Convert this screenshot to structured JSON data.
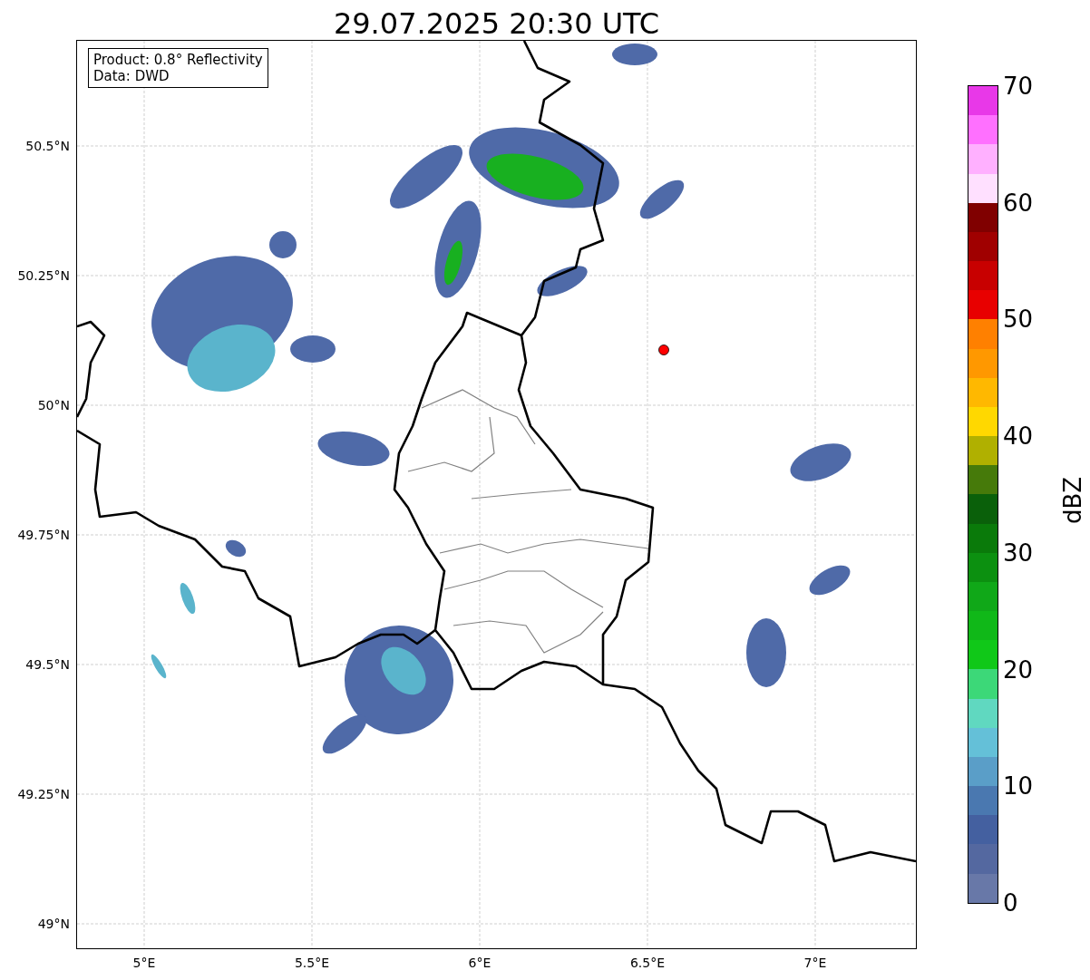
{
  "title": "29.07.2025 20:30 UTC",
  "legend": [
    "Product: 0.8° Reflectivity",
    "Data: DWD"
  ],
  "map": {
    "lon_labels": [
      "5°E",
      "5.5°E",
      "6°E",
      "6.5°E",
      "7°E"
    ],
    "lat_labels": [
      "50.5°N",
      "50.25°N",
      "50°N",
      "49.75°N",
      "49.5°N",
      "49.25°N",
      "49°N"
    ]
  },
  "colorbar": {
    "label": "dBZ",
    "ticks": [
      "70",
      "60",
      "50",
      "40",
      "30",
      "20",
      "10",
      "0"
    ]
  }
}
